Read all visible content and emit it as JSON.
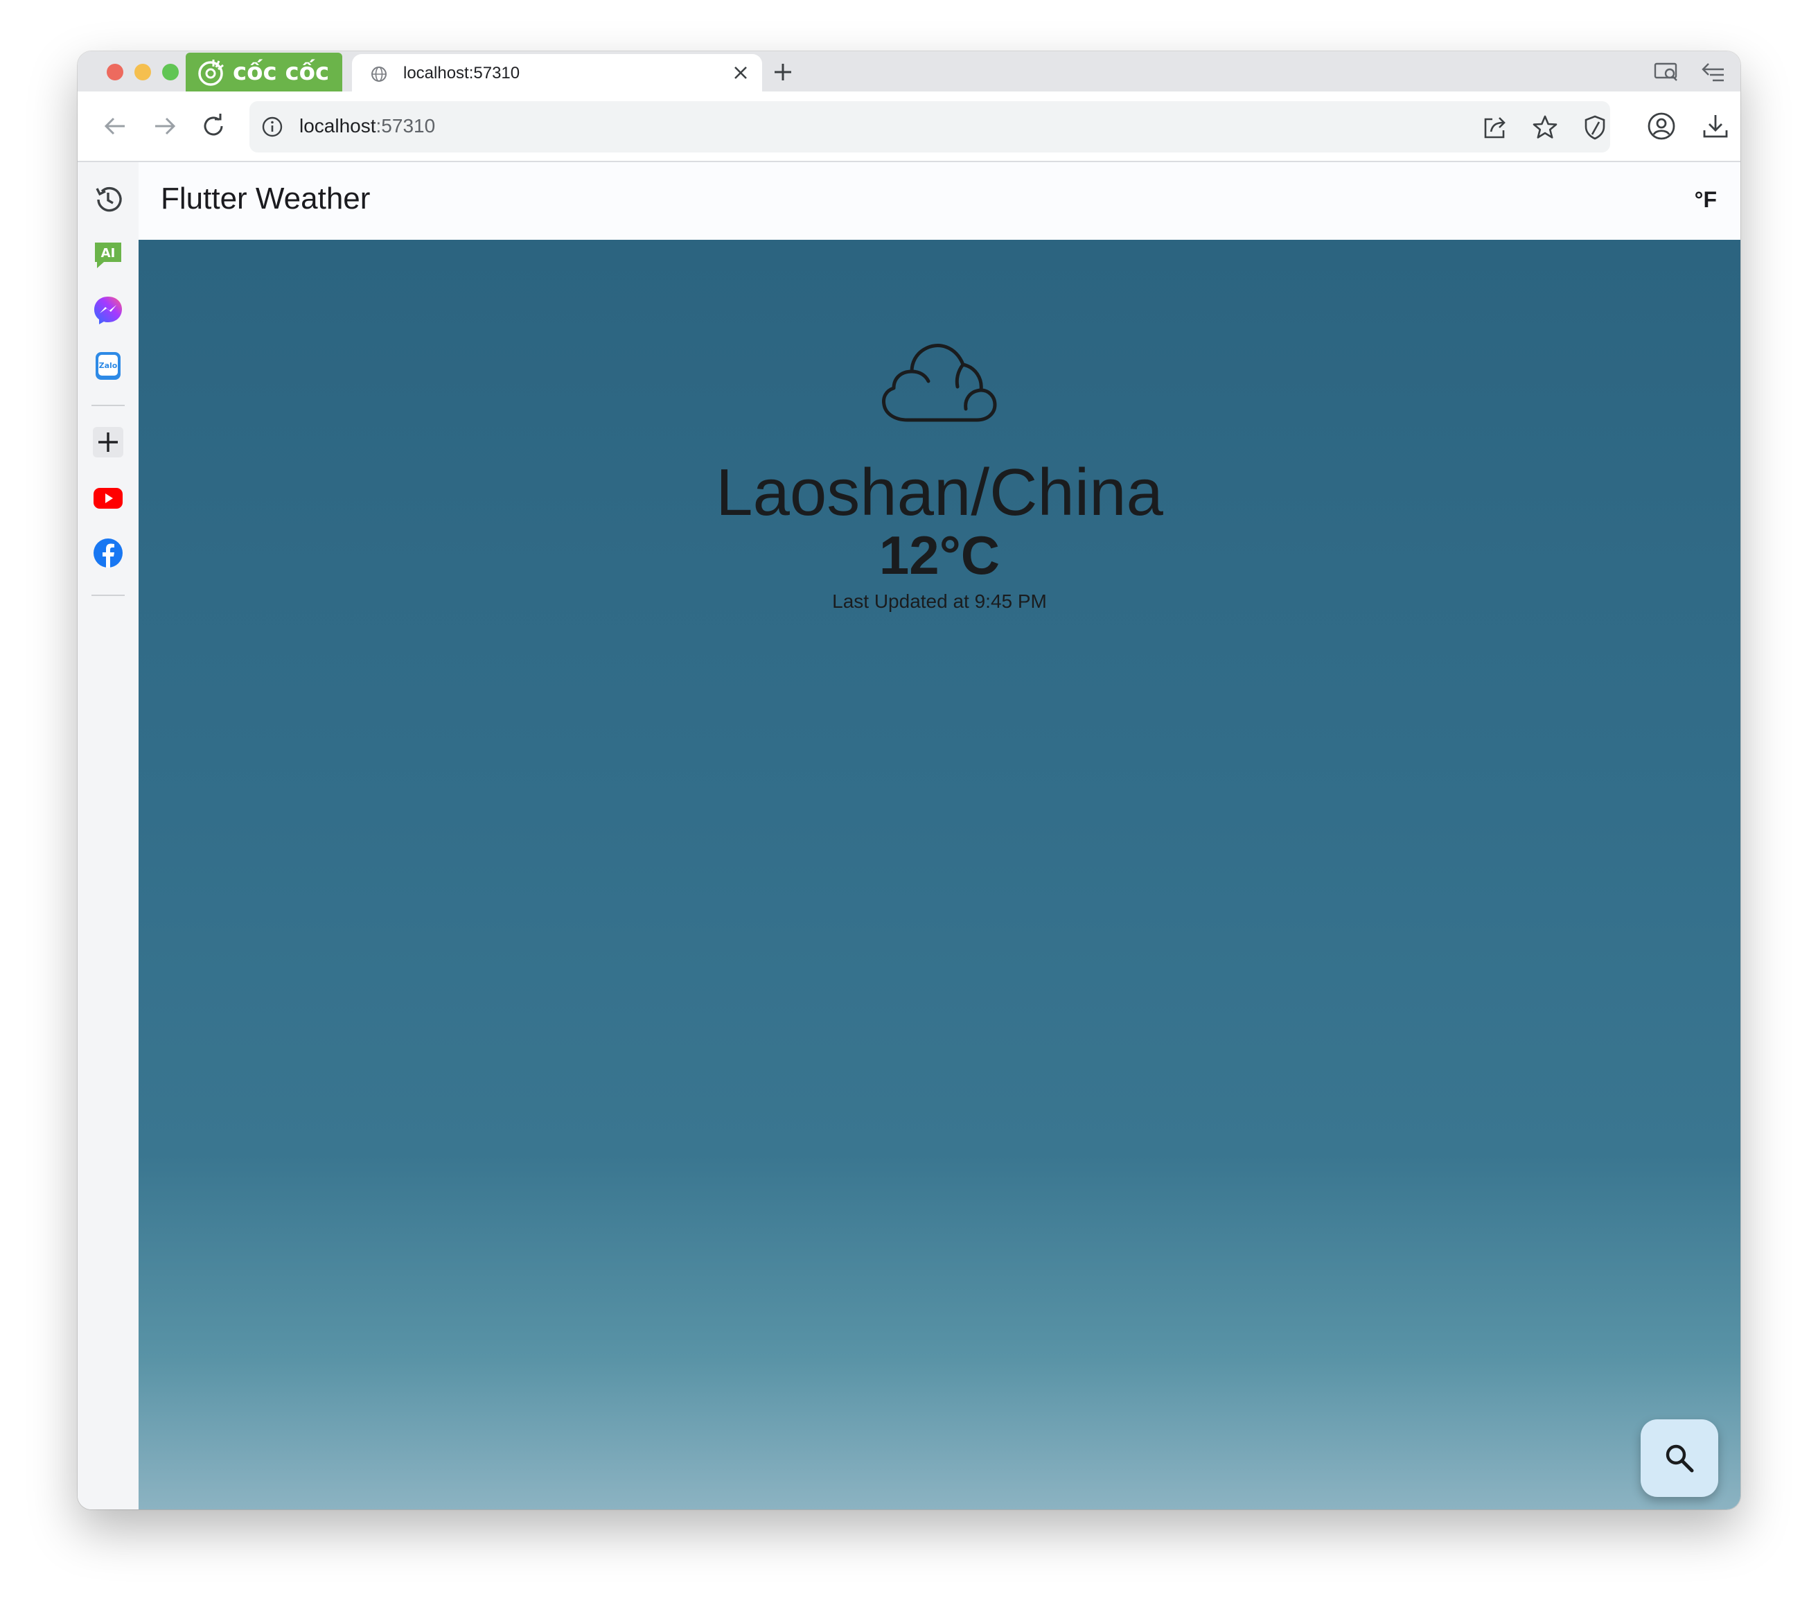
{
  "browser": {
    "brand_name": "cốc cốc",
    "tab": {
      "title": "localhost:57310"
    },
    "omnibox": {
      "host": "localhost",
      "port": ":57310"
    }
  },
  "app": {
    "title": "Flutter Weather",
    "unit_toggle_label": "°F",
    "weather": {
      "condition_icon": "cloud-icon",
      "location": "Laoshan/China",
      "temperature": "12°C",
      "last_updated": "Last Updated at 9:45 PM"
    },
    "fab_icon": "search-icon"
  },
  "colors": {
    "brand_green": "#6bb44a",
    "gradient_top": "#2c6480",
    "gradient_bottom": "#8cb3c2",
    "fab_background": "#d4e9f7"
  }
}
